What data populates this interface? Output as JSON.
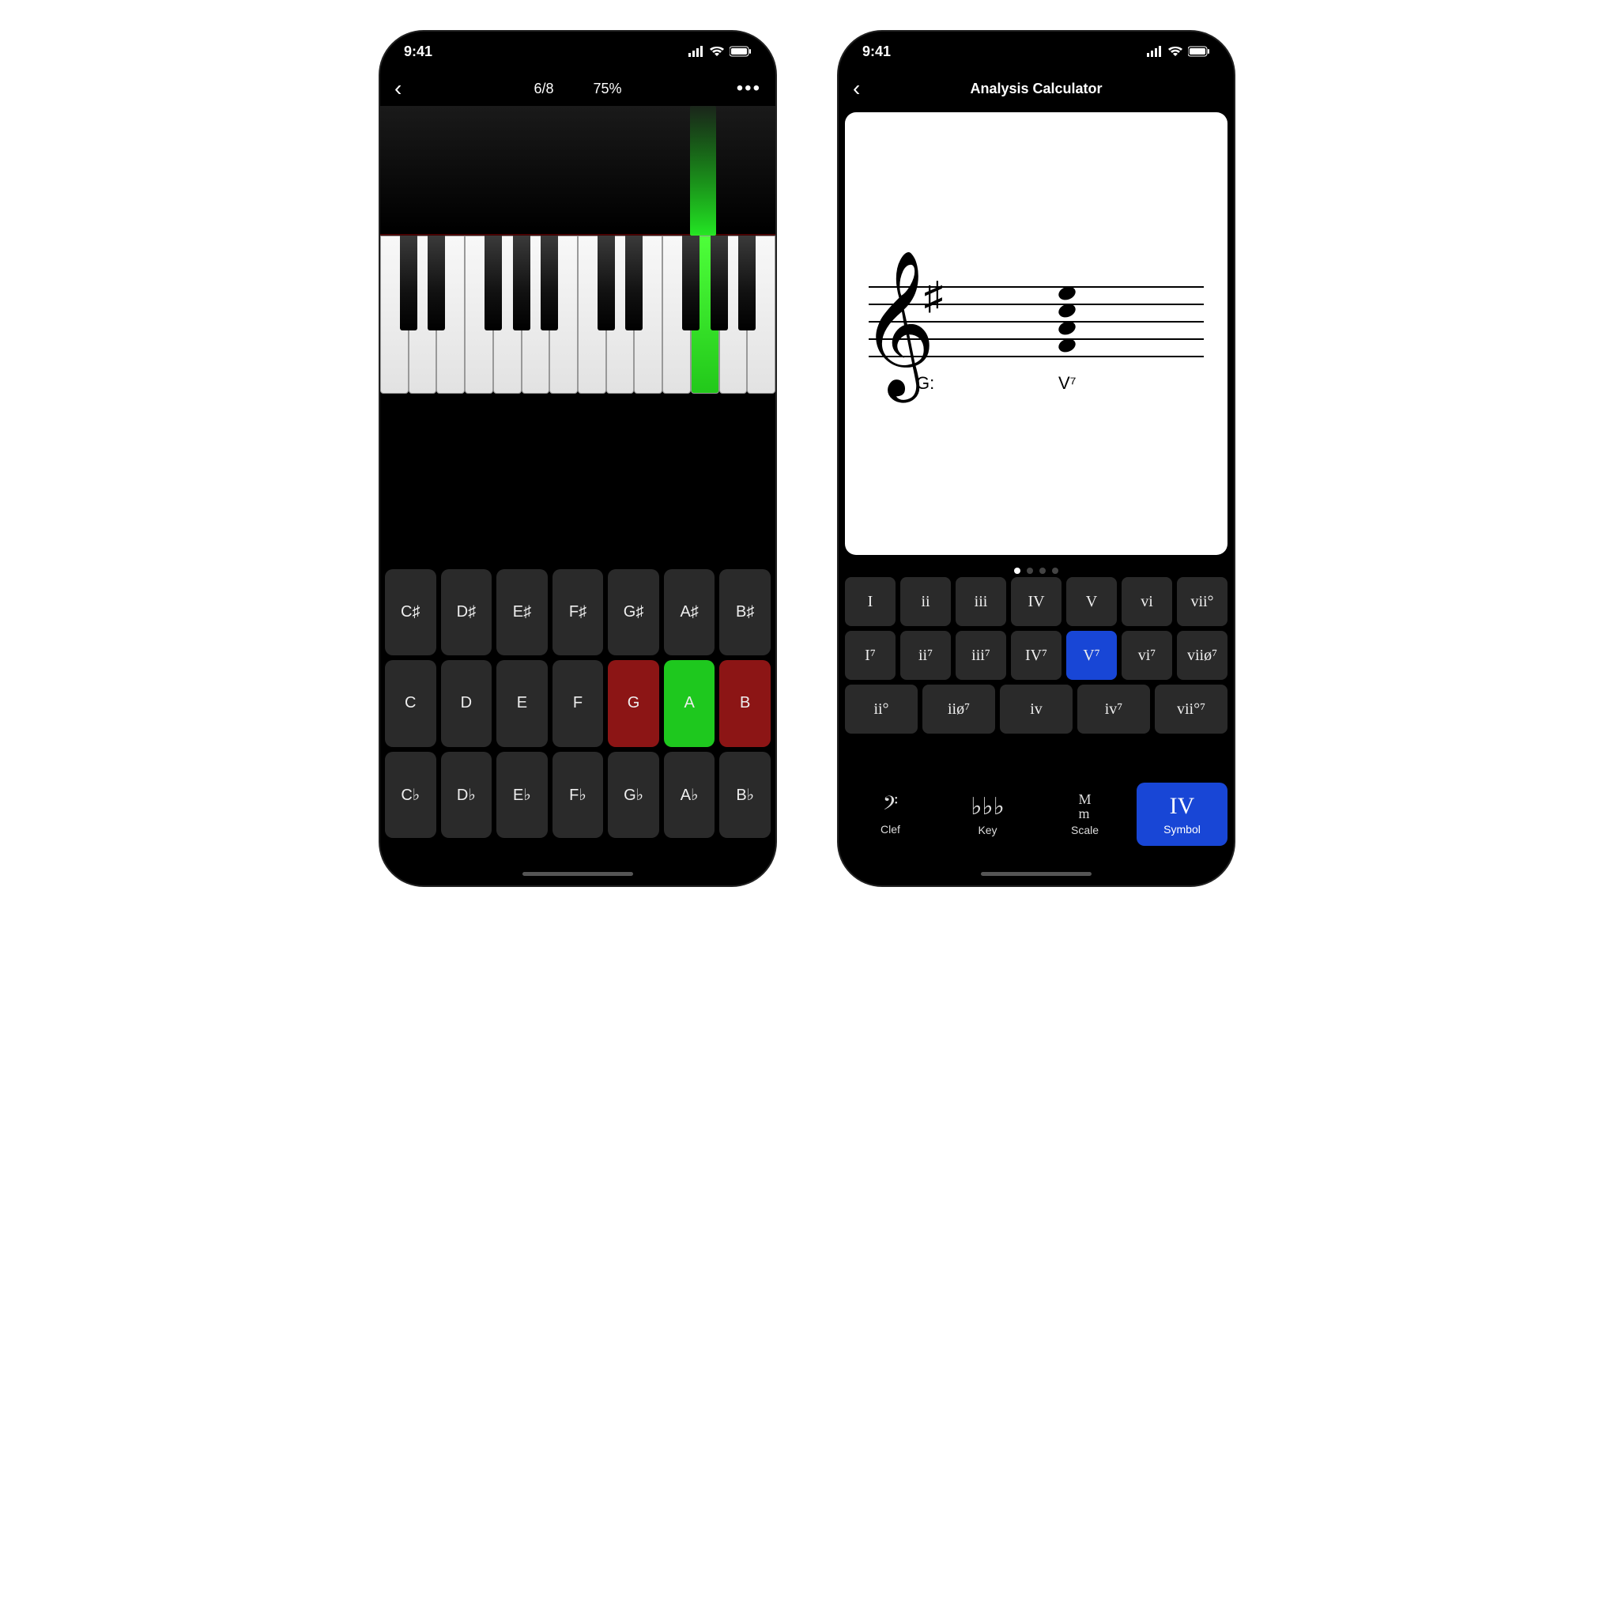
{
  "status": {
    "time": "9:41"
  },
  "phone1": {
    "progress": "6/8",
    "percent": "75%",
    "highlightedWhiteKeyIndex": 11,
    "notes_sharp": [
      "C♯",
      "D♯",
      "E♯",
      "F♯",
      "G♯",
      "A♯",
      "B♯"
    ],
    "notes_nat": [
      "C",
      "D",
      "E",
      "F",
      "G",
      "A",
      "B"
    ],
    "notes_flat": [
      "C♭",
      "D♭",
      "E♭",
      "F♭",
      "G♭",
      "A♭",
      "B♭"
    ],
    "nat_states": [
      "",
      "",
      "",
      "",
      "red",
      "green",
      "red"
    ]
  },
  "phone2": {
    "title": "Analysis Calculator",
    "keyLabel": "G:",
    "chordLabel": "V⁷",
    "row1": [
      "I",
      "ii",
      "iii",
      "IV",
      "V",
      "vi",
      "vii°"
    ],
    "row2": [
      "I⁷",
      "ii⁷",
      "iii⁷",
      "IV⁷",
      "V⁷",
      "vi⁷",
      "viiø⁷"
    ],
    "row2_selectedIndex": 4,
    "row3": [
      "ii°",
      "iiø⁷",
      "iv",
      "iv⁷",
      "vii°⁷"
    ],
    "tabs": [
      {
        "label": "Clef",
        "icon": "bass-clef"
      },
      {
        "label": "Key",
        "icon": "flats"
      },
      {
        "label": "Scale",
        "icon": "Mm"
      },
      {
        "label": "Symbol",
        "icon": "IV",
        "active": true
      }
    ]
  }
}
